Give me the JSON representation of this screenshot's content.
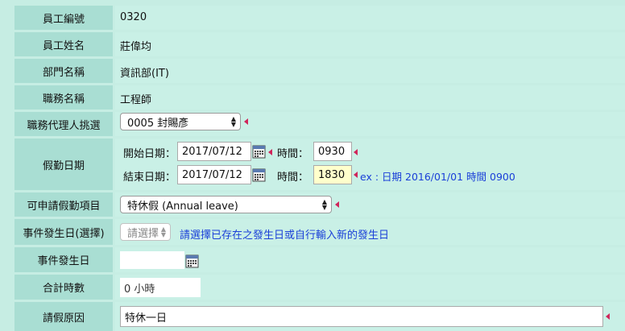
{
  "labels": {
    "emp_no": "員工編號",
    "emp_name": "員工姓名",
    "dept": "部門名稱",
    "title": "職務名稱",
    "proxy": "職務代理人挑選",
    "leave_date": "假勤日期",
    "leave_type": "可申請假勤項目",
    "event_select": "事件發生日(選擇)",
    "event_date": "事件發生日",
    "total_hours": "合計時數",
    "reason": "請假原因"
  },
  "values": {
    "emp_no": "0320",
    "emp_name": "莊偉均",
    "dept": "資訊部(IT)",
    "title": "工程師"
  },
  "proxy_select": {
    "selected": "0005 封賜彥"
  },
  "start": {
    "label": "開始日期：",
    "date": "2017/07/12",
    "time_label": "時間：",
    "time": "0930"
  },
  "end": {
    "label": "結束日期：",
    "date": "2017/07/12",
    "time_label": "時間：",
    "time": "1830"
  },
  "format_hint": "ex : 日期 2016/01/01 時間 0900",
  "leave_type_select": {
    "selected": "特休假 (Annual leave)"
  },
  "event_select": {
    "selected": "請選擇",
    "hint": "請選擇已存在之發生日或自行輸入新的發生日"
  },
  "event_date_value": "",
  "total_hours": "0 小時",
  "reason": "特休一日",
  "colors": {
    "label_bg": "#a9ded3",
    "value_bg": "#c9f0e6",
    "page_bg": "#c6ede3",
    "required_mark": "#d0255a",
    "hint_text": "#1a3fd8",
    "highlight_input": "#ffffcc"
  }
}
